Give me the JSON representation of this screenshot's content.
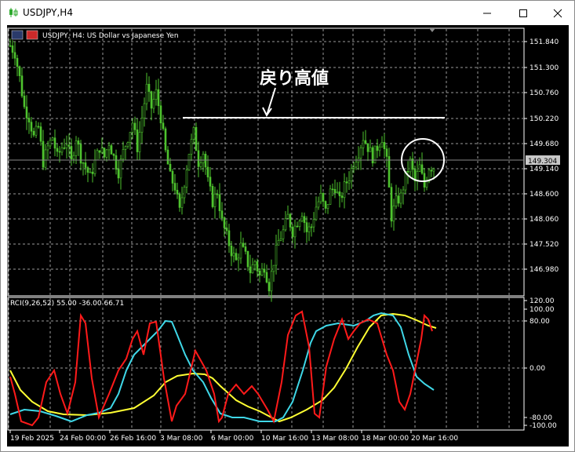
{
  "window": {
    "title": "USDJPY,H4"
  },
  "chart": {
    "header_text": "USDJPY, H4:  US Dollar vs Japanese Yen",
    "annotation": "戻り高値",
    "price_marker": "149.304",
    "price_axis": [
      "151.840",
      "151.300",
      "150.760",
      "150.220",
      "149.680",
      "149.140",
      "148.600",
      "148.060",
      "147.520",
      "146.980"
    ],
    "time_axis": [
      "19 Feb 2025",
      "24 Feb 00:00",
      "26 Feb 16:00",
      "3 Mar 08:00",
      "6 Mar 00:00",
      "10 Mar 16:00",
      "13 Mar 08:00",
      "18 Mar 00:00",
      "20 Mar 16:00"
    ]
  },
  "indicator": {
    "label": "RCI(9,26,52) 55.00 -36.00 66.71",
    "axis": [
      "120.00",
      "100.00",
      "80.00",
      "0.00",
      "-80.00",
      "-100.00"
    ]
  },
  "colors": {
    "candle": "#4ec32e",
    "grid": "#9a9a9a",
    "rci_fast": "#ff1a1a",
    "rci_mid": "#3fd8e8",
    "rci_slow": "#ffff33"
  },
  "chart_data": {
    "type": "candlestick",
    "symbol": "USDJPY",
    "timeframe": "H4",
    "ylim": [
      146.7,
      152.1
    ],
    "close_path": [
      [
        0,
        151.75
      ],
      [
        2,
        151.6
      ],
      [
        4,
        151.1
      ],
      [
        6,
        150.5
      ],
      [
        8,
        150.3
      ],
      [
        10,
        149.9
      ],
      [
        12,
        150.1
      ],
      [
        14,
        149.4
      ],
      [
        16,
        149.7
      ],
      [
        18,
        149.9
      ],
      [
        20,
        149.5
      ],
      [
        22,
        149.7
      ],
      [
        24,
        149.8
      ],
      [
        26,
        149.4
      ],
      [
        28,
        149.9
      ],
      [
        30,
        149.5
      ],
      [
        32,
        149.3
      ],
      [
        34,
        149.1
      ],
      [
        36,
        149.4
      ],
      [
        38,
        149.7
      ],
      [
        40,
        149.5
      ],
      [
        42,
        149.8
      ],
      [
        44,
        149.5
      ],
      [
        46,
        149.2
      ],
      [
        48,
        149.6
      ],
      [
        50,
        149.9
      ],
      [
        52,
        150.2
      ],
      [
        54,
        149.7
      ],
      [
        56,
        150.3
      ],
      [
        58,
        150.9
      ],
      [
        60,
        150.5
      ],
      [
        62,
        150.8
      ],
      [
        64,
        150.3
      ],
      [
        66,
        149.6
      ],
      [
        68,
        149.1
      ],
      [
        70,
        148.9
      ],
      [
        72,
        148.4
      ],
      [
        74,
        149.0
      ],
      [
        76,
        149.6
      ],
      [
        78,
        150.0
      ],
      [
        80,
        149.4
      ],
      [
        82,
        149.6
      ],
      [
        84,
        149.0
      ],
      [
        86,
        148.6
      ],
      [
        88,
        148.8
      ],
      [
        90,
        148.2
      ],
      [
        92,
        147.9
      ],
      [
        94,
        147.6
      ],
      [
        96,
        147.4
      ],
      [
        98,
        147.7
      ],
      [
        100,
        147.5
      ],
      [
        102,
        147.2
      ],
      [
        104,
        147.4
      ],
      [
        106,
        147.1
      ],
      [
        108,
        147.3
      ],
      [
        110,
        146.9
      ],
      [
        112,
        147.4
      ],
      [
        114,
        147.8
      ],
      [
        116,
        148.0
      ],
      [
        118,
        148.3
      ],
      [
        120,
        148.0
      ],
      [
        122,
        148.2
      ],
      [
        124,
        148.4
      ],
      [
        126,
        148.0
      ],
      [
        128,
        148.1
      ],
      [
        130,
        148.5
      ],
      [
        132,
        148.7
      ],
      [
        134,
        148.4
      ],
      [
        136,
        148.8
      ],
      [
        138,
        148.9
      ],
      [
        140,
        148.6
      ],
      [
        142,
        148.9
      ],
      [
        144,
        149.1
      ],
      [
        146,
        149.4
      ],
      [
        148,
        149.6
      ],
      [
        150,
        149.9
      ],
      [
        152,
        149.7
      ],
      [
        154,
        149.5
      ],
      [
        156,
        149.7
      ],
      [
        158,
        149.9
      ],
      [
        160,
        149.4
      ],
      [
        162,
        148.3
      ],
      [
        164,
        148.6
      ],
      [
        166,
        148.7
      ],
      [
        168,
        149.1
      ],
      [
        170,
        149.4
      ],
      [
        172,
        149.0
      ],
      [
        174,
        149.3
      ],
      [
        176,
        148.9
      ],
      [
        178,
        149.3
      ],
      [
        180,
        149.3
      ]
    ],
    "rci": [
      {
        "name": "RCI 9",
        "values": []
      },
      {
        "name": "RCI 26",
        "values": []
      },
      {
        "name": "RCI 52",
        "values": []
      }
    ]
  }
}
